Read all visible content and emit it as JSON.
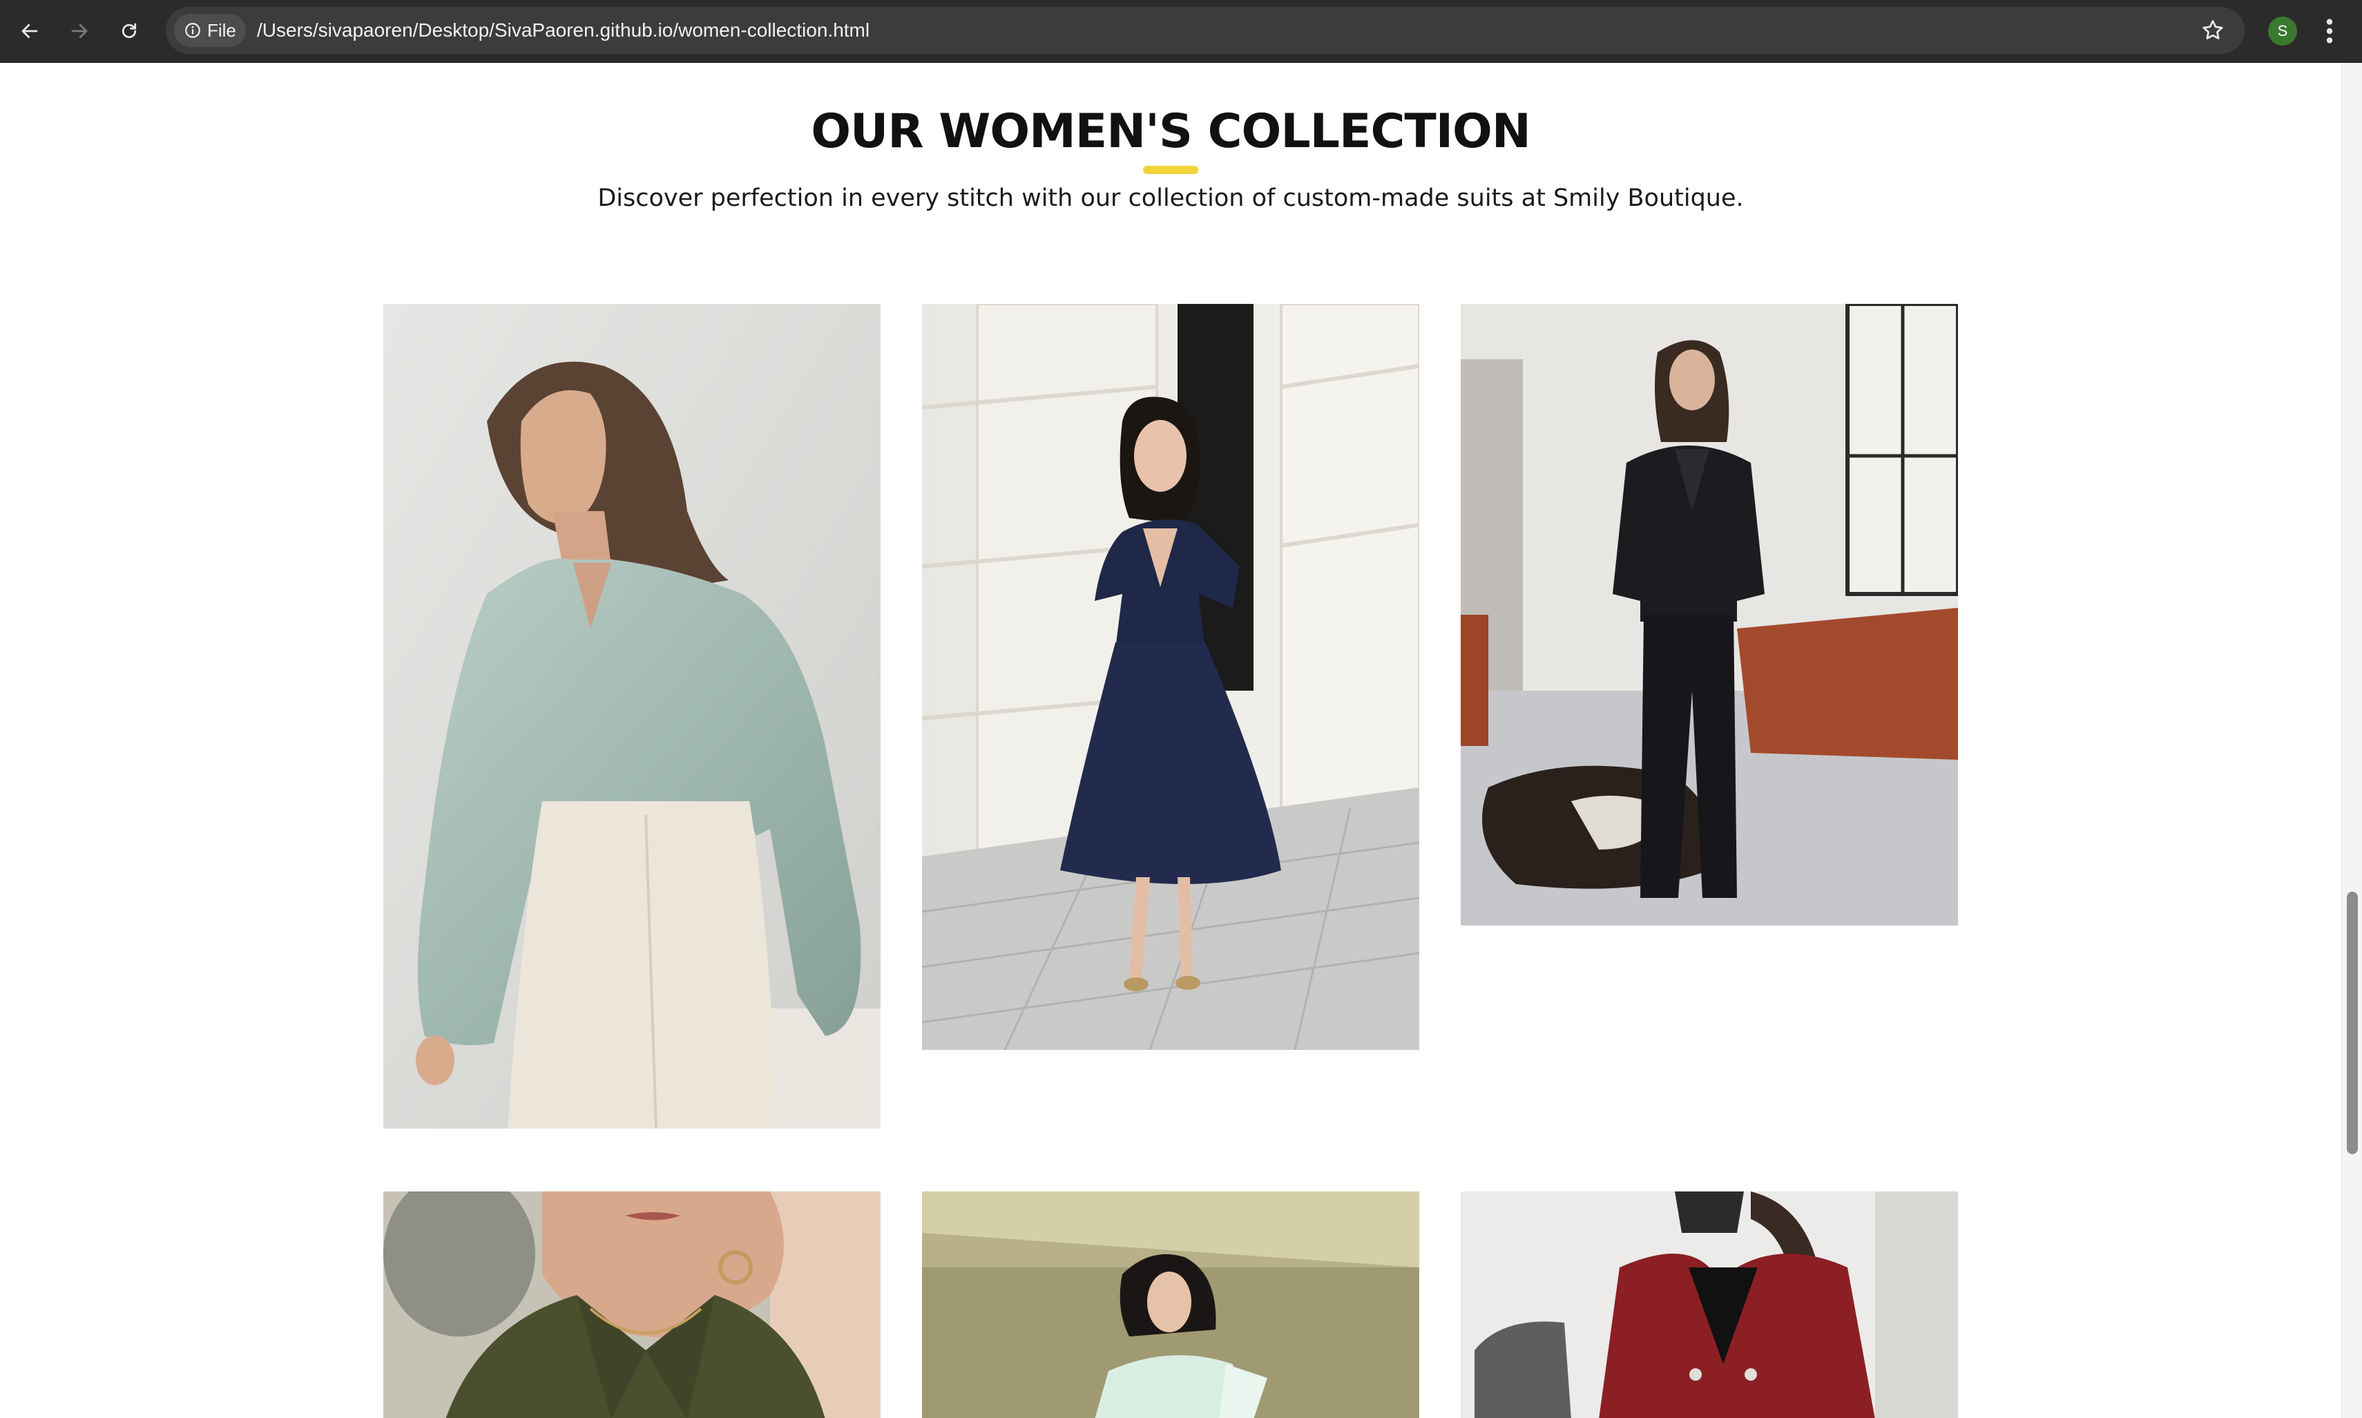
{
  "browser": {
    "file_chip_label": "File",
    "url": "/Users/sivapaoren/Desktop/SivaPaoren.github.io/women-collection.html",
    "profile_initial": "S",
    "icons": [
      "back-arrow-icon",
      "forward-arrow-icon",
      "reload-icon",
      "info-icon",
      "star-icon",
      "kebab-menu-icon"
    ]
  },
  "page": {
    "heading": "OUR WOMEN'S COLLECTION",
    "subtitle": "Discover perfection in every stitch with our collection of custom-made suits at Smily Boutique.",
    "accent_color": "#f2d43a"
  },
  "products": [
    {
      "name": "sage-satin-blouse"
    },
    {
      "name": "navy-midi-dress"
    },
    {
      "name": "black-three-piece-suit"
    },
    {
      "name": "olive-shirt"
    },
    {
      "name": "mint-draped-gown"
    },
    {
      "name": "red-cropped-blazer"
    }
  ]
}
